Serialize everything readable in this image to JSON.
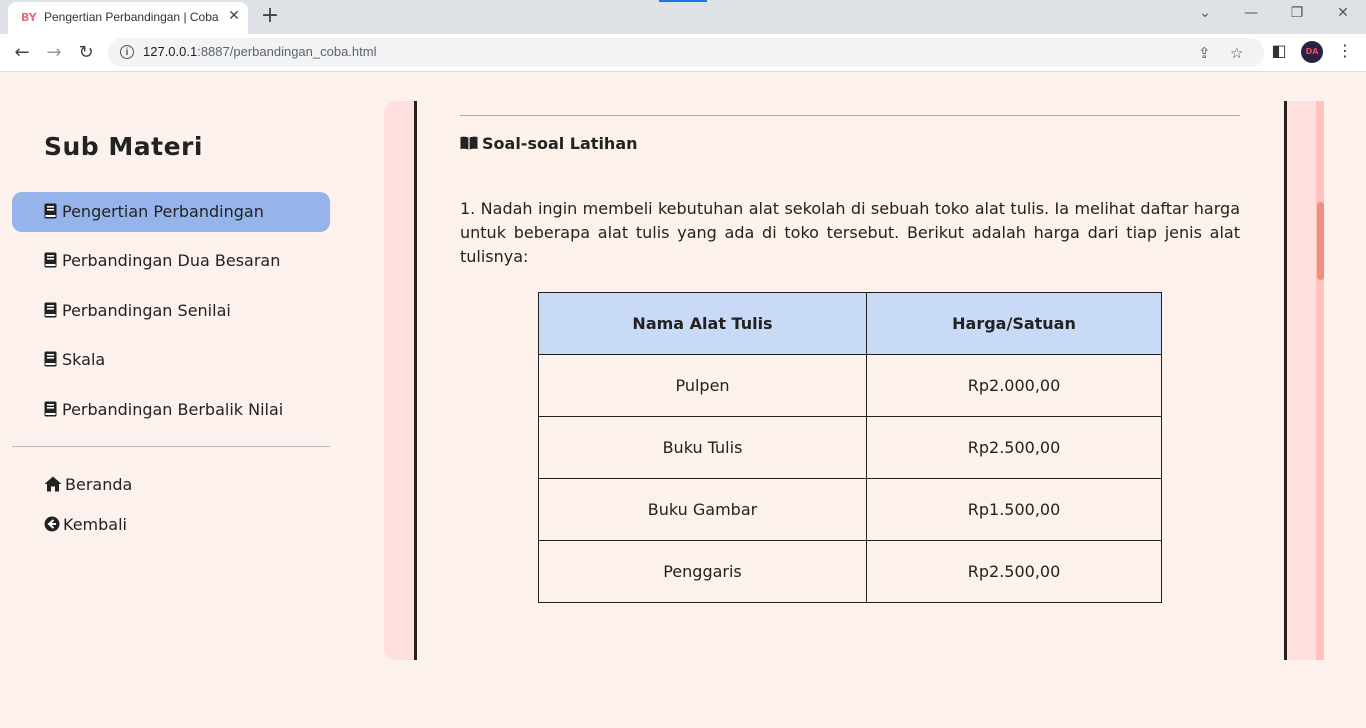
{
  "browser": {
    "tab_title": "Pengertian Perbandingan | Coba",
    "favicon_text": "BY",
    "url_host": "127.0.0.1",
    "url_rest": ":8887/perbandingan_coba.html",
    "icons": [
      "back-icon",
      "forward-icon",
      "reload-icon",
      "info-icon",
      "share-icon",
      "star-icon",
      "sidepanel-icon",
      "kebab-menu-icon"
    ],
    "avatar_text": "DA"
  },
  "sidebar": {
    "title": "Sub Materi",
    "items": [
      {
        "label": "Pengertian Perbandingan",
        "active": true
      },
      {
        "label": "Perbandingan Dua Besaran",
        "active": false
      },
      {
        "label": "Perbandingan Senilai",
        "active": false
      },
      {
        "label": "Skala",
        "active": false
      },
      {
        "label": "Perbandingan Berbalik Nilai",
        "active": false
      }
    ],
    "links": [
      {
        "label": "Beranda",
        "icon": "home-icon"
      },
      {
        "label": "Kembali",
        "icon": "arrow-left-circle-icon"
      }
    ]
  },
  "content": {
    "section_title": "Soal-soal Latihan",
    "question": "1. Nadah ingin membeli kebutuhan alat sekolah di sebuah toko alat tulis. Ia melihat daftar harga untuk beberapa alat tulis yang ada di toko tersebut. Berikut adalah harga dari tiap jenis alat tulisnya:",
    "table": {
      "headers": [
        "Nama Alat Tulis",
        "Harga/Satuan"
      ],
      "rows": [
        [
          "Pulpen",
          "Rp2.000,00"
        ],
        [
          "Buku Tulis",
          "Rp2.500,00"
        ],
        [
          "Buku Gambar",
          "Rp1.500,00"
        ],
        [
          "Penggaris",
          "Rp2.500,00"
        ]
      ]
    }
  },
  "colors": {
    "page_bg": "#fcf1ec",
    "active_item": "#96b4ec",
    "table_header": "#c9daf6",
    "content_frame": "#ffe0dd",
    "scroll_thumb": "#f58c80"
  }
}
